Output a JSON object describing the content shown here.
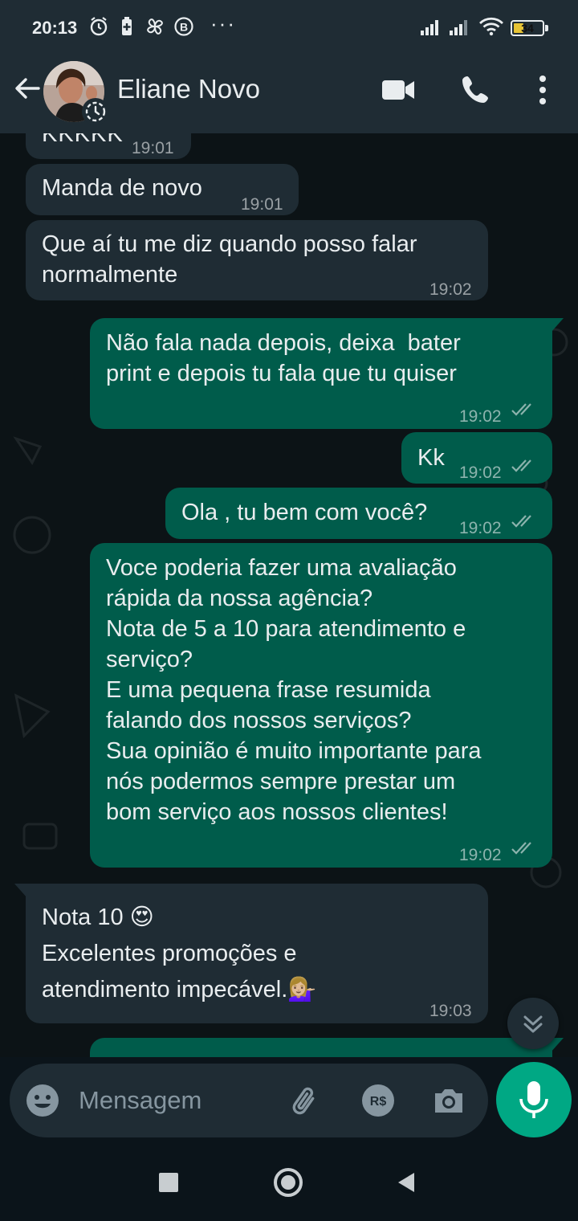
{
  "status_bar": {
    "time": "20:13",
    "dots": "···",
    "battery": "34",
    "battery_level": 0.34
  },
  "header": {
    "contact_name": "Eliane Novo"
  },
  "messages": [
    {
      "dir": "in",
      "text": "KKKKK",
      "time": "19:01"
    },
    {
      "dir": "in",
      "text": "Manda de novo",
      "time": "19:01"
    },
    {
      "dir": "in",
      "text": "Que aí tu me diz quando posso falar\nnormalmente",
      "time": "19:02"
    },
    {
      "dir": "out",
      "text": "Não fala nada depois, deixa  bater\nprint e depois tu fala que tu quiser",
      "time": "19:02"
    },
    {
      "dir": "out",
      "text": "Kk",
      "time": "19:02"
    },
    {
      "dir": "out",
      "text": "Ola , tu bem com você?",
      "time": "19:02"
    },
    {
      "dir": "out",
      "text": "Voce poderia fazer uma avaliação\nrápida da nossa agência?\nNota de 5 a 10 para atendimento e\nserviço?\nE uma pequena frase resumida\nfalando dos nossos serviços?\nSua opinião é muito importante para\nnós podermos sempre prestar um\nbom serviço aos nossos clientes!",
      "time": "19:02"
    },
    {
      "dir": "in",
      "text": "Nota 10 😍\nExcelentes promoções e\natendimento impecável.💁🏼‍♀️",
      "time": "19:03"
    }
  ],
  "input": {
    "placeholder": "Mensagem"
  },
  "colors": {
    "incoming": "#1f2c34",
    "outgoing": "#005c4b",
    "accent": "#00a884"
  }
}
